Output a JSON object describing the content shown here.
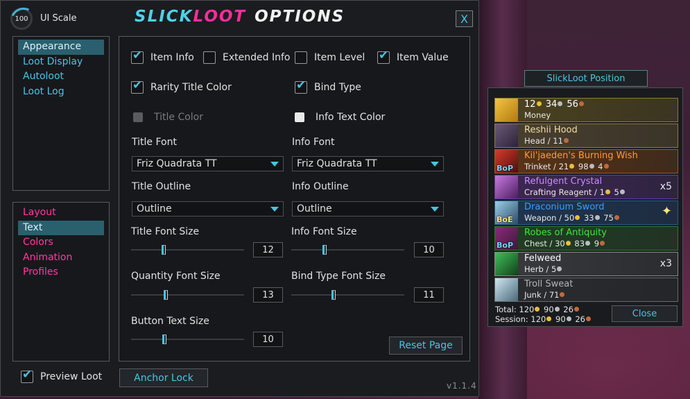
{
  "colors": {
    "accent_cyan": "#48c3e3",
    "accent_pink": "#ff2ca0",
    "panel_bg": "#17181b",
    "window_bg": "#1b1c1f",
    "quality_money": "#e0c35a",
    "quality_artifact": "#e6cc80",
    "quality_legendary": "#ff8000",
    "quality_epic": "#a335ee",
    "quality_rare": "#0070dd",
    "quality_uncommon": "#1eff00",
    "quality_common": "#ffffff",
    "quality_poor": "#9d9d9d"
  },
  "header": {
    "ui_scale_value": "100",
    "ui_scale_label": "UI Scale",
    "title_part1": "SLICK",
    "title_part2": "LOOT",
    "title_part3": "OPTIONS",
    "close_label": "X"
  },
  "nav_top": [
    {
      "label": "Appearance",
      "active": true
    },
    {
      "label": "Loot Display",
      "active": false
    },
    {
      "label": "Autoloot",
      "active": false
    },
    {
      "label": "Loot Log",
      "active": false
    }
  ],
  "nav_bottom": [
    {
      "label": "Layout",
      "active": false
    },
    {
      "label": "Text",
      "active": true
    },
    {
      "label": "Colors",
      "active": false
    },
    {
      "label": "Animation",
      "active": false
    },
    {
      "label": "Profiles",
      "active": false
    }
  ],
  "options": {
    "item_info": {
      "label": "Item Info",
      "checked": true
    },
    "extended_info": {
      "label": "Extended Info",
      "checked": false
    },
    "item_level": {
      "label": "Item Level",
      "checked": false
    },
    "item_value": {
      "label": "Item Value",
      "checked": true
    },
    "rarity_title_color": {
      "label": "Rarity Title Color",
      "checked": true
    },
    "bind_type": {
      "label": "Bind Type",
      "checked": true
    },
    "title_color": {
      "label": "Title Color",
      "disabled": true
    },
    "info_text_color": {
      "label": "Info Text Color"
    },
    "title_font_label": "Title Font",
    "title_font_value": "Friz Quadrata TT",
    "info_font_label": "Info Font",
    "info_font_value": "Friz Quadrata TT",
    "title_outline_label": "Title Outline",
    "title_outline_value": "Outline",
    "info_outline_label": "Info Outline",
    "info_outline_value": "Outline",
    "title_font_size": {
      "label": "Title Font Size",
      "value": "12"
    },
    "info_font_size": {
      "label": "Info Font Size",
      "value": "10"
    },
    "quantity_font_size": {
      "label": "Quantity Font Size",
      "value": "13"
    },
    "bind_type_font_size": {
      "label": "Bind Type Font Size",
      "value": "11"
    },
    "button_text_size": {
      "label": "Button Text Size",
      "value": "10"
    },
    "reset_label": "Reset Page"
  },
  "footer": {
    "preview_loot_label": "Preview Loot",
    "preview_loot_checked": true,
    "anchor_lock_label": "Anchor Lock",
    "version": "v1.1.4"
  },
  "loot_window": {
    "position_label": "SlickLoot Position",
    "items": [
      {
        "name": "12 ● 34 ● 56 ●",
        "money": [
          "12",
          "34",
          "56"
        ],
        "sub": "Money",
        "quality": "money",
        "icon": "gold-coins-icon",
        "bind": "",
        "qty": ""
      },
      {
        "name": "Reshii Hood",
        "sub_type": "Head",
        "sub_money": [
          "",
          "",
          "11"
        ],
        "quality": "artifact",
        "icon": "hood-icon",
        "bind": "",
        "qty": ""
      },
      {
        "name": "Kil'jaeden's Burning Wish",
        "sub_type": "Trinket",
        "sub_money": [
          "21",
          "98",
          "4"
        ],
        "quality": "legendary",
        "icon": "trinket-icon",
        "bind": "BoP",
        "qty": ""
      },
      {
        "name": "Refulgent Crystal",
        "sub_type": "Crafting Reagent",
        "sub_money": [
          "1",
          "5",
          ""
        ],
        "quality": "epic",
        "icon": "crystal-icon",
        "bind": "",
        "qty": "x5"
      },
      {
        "name": "Draconium Sword",
        "sub_type": "Weapon",
        "sub_money": [
          "50",
          "33",
          "75"
        ],
        "quality": "rare",
        "icon": "sword-icon",
        "bind": "BoE",
        "qty": "✦"
      },
      {
        "name": "Robes of Antiquity",
        "sub_type": "Chest",
        "sub_money": [
          "30",
          "83",
          "9"
        ],
        "quality": "uncommon",
        "icon": "robe-icon",
        "bind": "BoP",
        "qty": ""
      },
      {
        "name": "Felweed",
        "sub_type": "Herb",
        "sub_money": [
          "",
          "5",
          ""
        ],
        "quality": "common",
        "icon": "herb-icon",
        "bind": "",
        "qty": "x3"
      },
      {
        "name": "Troll Sweat",
        "sub_type": "Junk",
        "sub_money": [
          "",
          "",
          "71"
        ],
        "quality": "poor",
        "icon": "bottle-icon",
        "bind": "",
        "qty": ""
      }
    ],
    "total_label": "Total:",
    "total": [
      "120",
      "90",
      "26"
    ],
    "session_label": "Session:",
    "session": [
      "120",
      "90",
      "26"
    ],
    "close_label": "Close"
  }
}
